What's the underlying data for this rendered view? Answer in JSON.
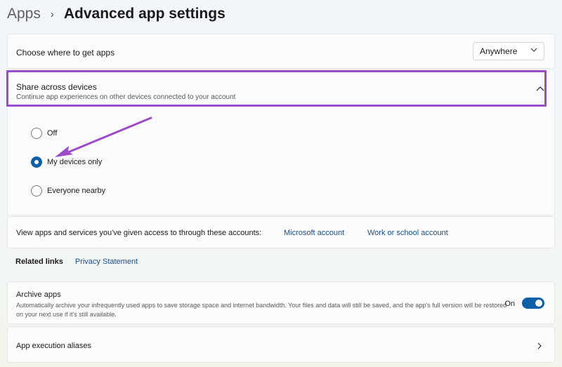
{
  "breadcrumb": {
    "parent": "Apps",
    "separator": "›",
    "current": "Advanced app settings"
  },
  "where": {
    "label": "Choose where to get apps",
    "selected": "Anywhere"
  },
  "share": {
    "title": "Share across devices",
    "subtitle": "Continue app experiences on other devices connected to your account",
    "options": [
      {
        "label": "Off",
        "checked": false
      },
      {
        "label": "My devices only",
        "checked": true
      },
      {
        "label": "Everyone nearby",
        "checked": false
      }
    ]
  },
  "accounts": {
    "label": "View apps and services you've given access to through these accounts:",
    "links": [
      "Microsoft account",
      "Work or school account"
    ]
  },
  "related": {
    "label": "Related links",
    "link": "Privacy Statement"
  },
  "archive": {
    "title": "Archive apps",
    "description": "Automatically archive your infrequently used apps to save storage space and internet bandwidth. Your files and data will still be saved, and the app's full version will be restored on your next use if it's still available.",
    "toggle_text": "On",
    "toggle_on": true
  },
  "aliases": {
    "label": "App execution aliases"
  },
  "colors": {
    "accent": "#0e5ea8",
    "highlight": "#9b4dc9",
    "link": "#1a4f86"
  }
}
